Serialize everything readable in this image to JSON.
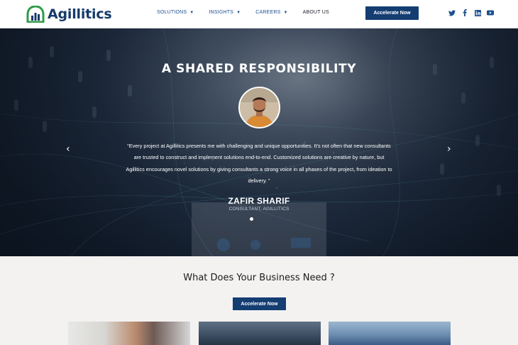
{
  "header": {
    "logo_text": "Agillitics",
    "nav": [
      {
        "label": "SOLUTIONS",
        "has_dropdown": true
      },
      {
        "label": "INSIGHTS",
        "has_dropdown": true
      },
      {
        "label": "CAREERS",
        "has_dropdown": true
      },
      {
        "label": "ABOUT US",
        "has_dropdown": false
      }
    ],
    "cta_label": "Accelerate Now",
    "social_icons": [
      "twitter-icon",
      "facebook-icon",
      "linkedin-icon",
      "youtube-icon"
    ]
  },
  "hero": {
    "title": "A SHARED RESPONSIBILITY",
    "quote": "“Every project at Agillitics presents me with challenging and unique opportunities. It’s not often that new consultants are trusted to construct and implement solutions end-to-end. Customized solutions are creative by nature, but Agillitics encourages novel solutions by giving consultants a strong voice in all phases of the project, from ideation to delivery. ”",
    "name": "ZAFIR SHARIF",
    "role": "CONSULTANT, AGILLITICS",
    "prev_arrow": "‹",
    "next_arrow": "›"
  },
  "section": {
    "title": "What Does Your Business Need ?",
    "cta_label": "Accelerate Now"
  },
  "colors": {
    "brand": "#143d72",
    "logo_green": "#2f9b4a",
    "nav_blue": "#1d4f8f"
  }
}
